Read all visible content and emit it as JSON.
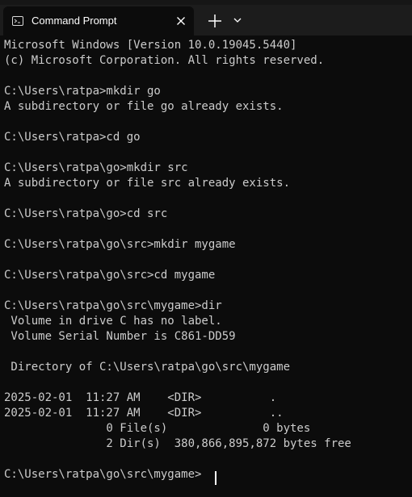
{
  "tab": {
    "title": "Command Prompt"
  },
  "terminal": {
    "lines": [
      "Microsoft Windows [Version 10.0.19045.5440]",
      "(c) Microsoft Corporation. All rights reserved.",
      "",
      "C:\\Users\\ratpa>mkdir go",
      "A subdirectory or file go already exists.",
      "",
      "C:\\Users\\ratpa>cd go",
      "",
      "C:\\Users\\ratpa\\go>mkdir src",
      "A subdirectory or file src already exists.",
      "",
      "C:\\Users\\ratpa\\go>cd src",
      "",
      "C:\\Users\\ratpa\\go\\src>mkdir mygame",
      "",
      "C:\\Users\\ratpa\\go\\src>cd mygame",
      "",
      "C:\\Users\\ratpa\\go\\src\\mygame>dir",
      " Volume in drive C has no label.",
      " Volume Serial Number is C861-DD59",
      "",
      " Directory of C:\\Users\\ratpa\\go\\src\\mygame",
      "",
      "2025-02-01  11:27 AM    <DIR>          .",
      "2025-02-01  11:27 AM    <DIR>          ..",
      "               0 File(s)              0 bytes",
      "               2 Dir(s)  380,866,895,872 bytes free",
      "",
      "C:\\Users\\ratpa\\go\\src\\mygame>"
    ]
  },
  "icons": {
    "tab_icon": "terminal-icon",
    "close": "close-icon",
    "new_tab": "plus-icon",
    "dropdown": "chevron-down-icon"
  },
  "colors": {
    "background": "#0c0c0c",
    "titlebar": "#1c1c1c",
    "text": "#cccccc"
  }
}
